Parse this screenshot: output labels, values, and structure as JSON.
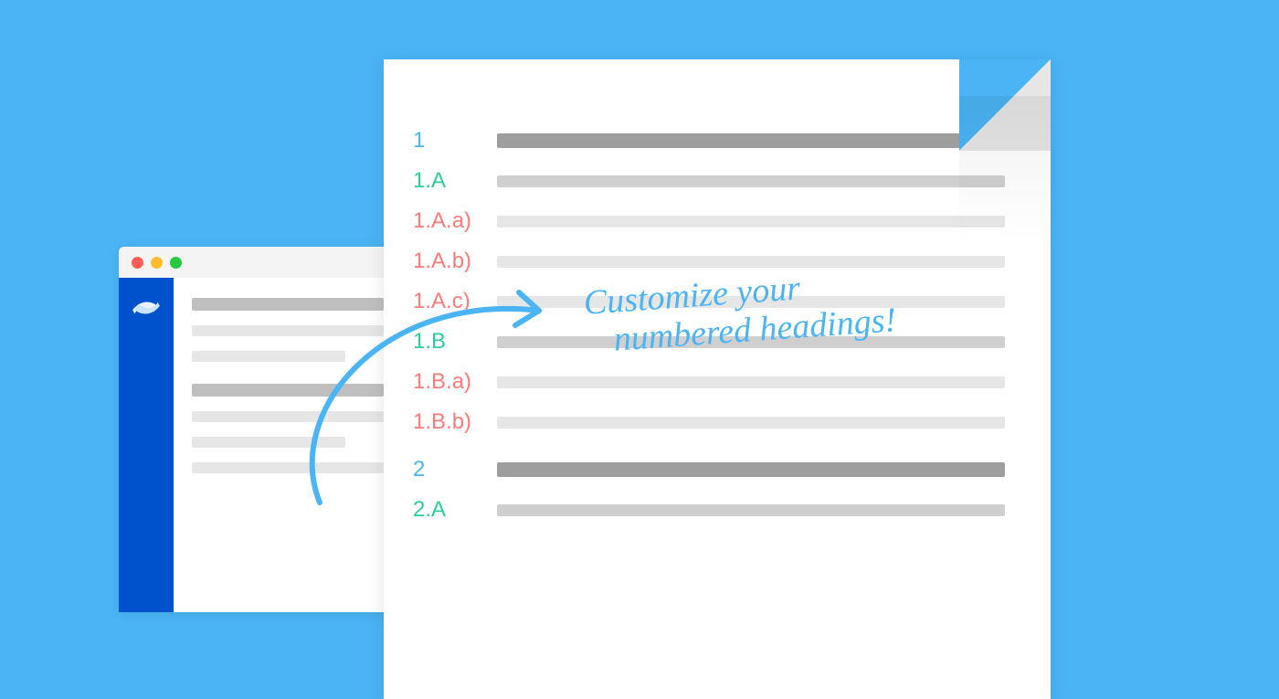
{
  "headings": {
    "r0": "1",
    "r1": "1.A",
    "r2": "1.A.a)",
    "r3": "1.A.b)",
    "r4": "1.A.c)",
    "r5": "1.B",
    "r6": "1.B.a)",
    "r7": "1.B.b)",
    "r8": "2",
    "r9": "2.A"
  },
  "callout": {
    "line1": "Customize your",
    "line2": "numbered headings!"
  }
}
